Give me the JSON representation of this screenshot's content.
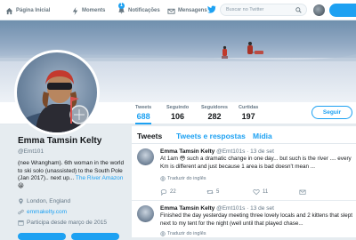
{
  "topnav": {
    "items": [
      {
        "label": "Página Inicial",
        "icon": "home-icon"
      },
      {
        "label": "Moments",
        "icon": "lightning-icon"
      },
      {
        "label": "Notificações",
        "icon": "bell-icon",
        "badge": "1"
      },
      {
        "label": "Mensagens",
        "icon": "envelope-icon"
      }
    ],
    "search_placeholder": "Buscar no Twitter"
  },
  "profile": {
    "name": "Emma Tamsin Kelty",
    "handle": "@Emt101",
    "bio_main": "(nee Wrangham). 6th woman in the world to ski solo (unassisted) to the South Pole (Jan 2017).. next up... ",
    "bio_link": "The River Amazon",
    "bio_emoji": "😀",
    "location": "London, England",
    "website": "emmakelty.com",
    "joined": "Participa desde março de 2015"
  },
  "stats": [
    {
      "label": "Tweets",
      "value": "688"
    },
    {
      "label": "Seguindo",
      "value": "106"
    },
    {
      "label": "Seguidores",
      "value": "282"
    },
    {
      "label": "Curtidas",
      "value": "197"
    }
  ],
  "follow_label": "Seguir",
  "tabs": [
    "Tweets",
    "Tweets e respostas",
    "Mídia"
  ],
  "tweets": [
    {
      "name": "Emma Tamsin Kelty",
      "handle": "@Emt101s",
      "date": "· 13 de set",
      "text": "At 1am 😳 such a dramatic change in one day... but such is the river .... every Km is different and just because 1 area is bad doesn't mean ...",
      "translate": "Traduzir do inglês",
      "replies": "22",
      "retweets": "5",
      "likes": "11"
    },
    {
      "name": "Emma Tamsin Kelty",
      "handle": "@Emt101s",
      "date": "· 13 de set",
      "text": "Finished the day yesterday meeting three lovely locals and 2 kittens that slept next to my tent for the night (well until that played chase...",
      "translate": "Traduzir do inglês"
    }
  ],
  "colors": {
    "accent": "#1da1f2",
    "background": "#e6ecf0"
  }
}
